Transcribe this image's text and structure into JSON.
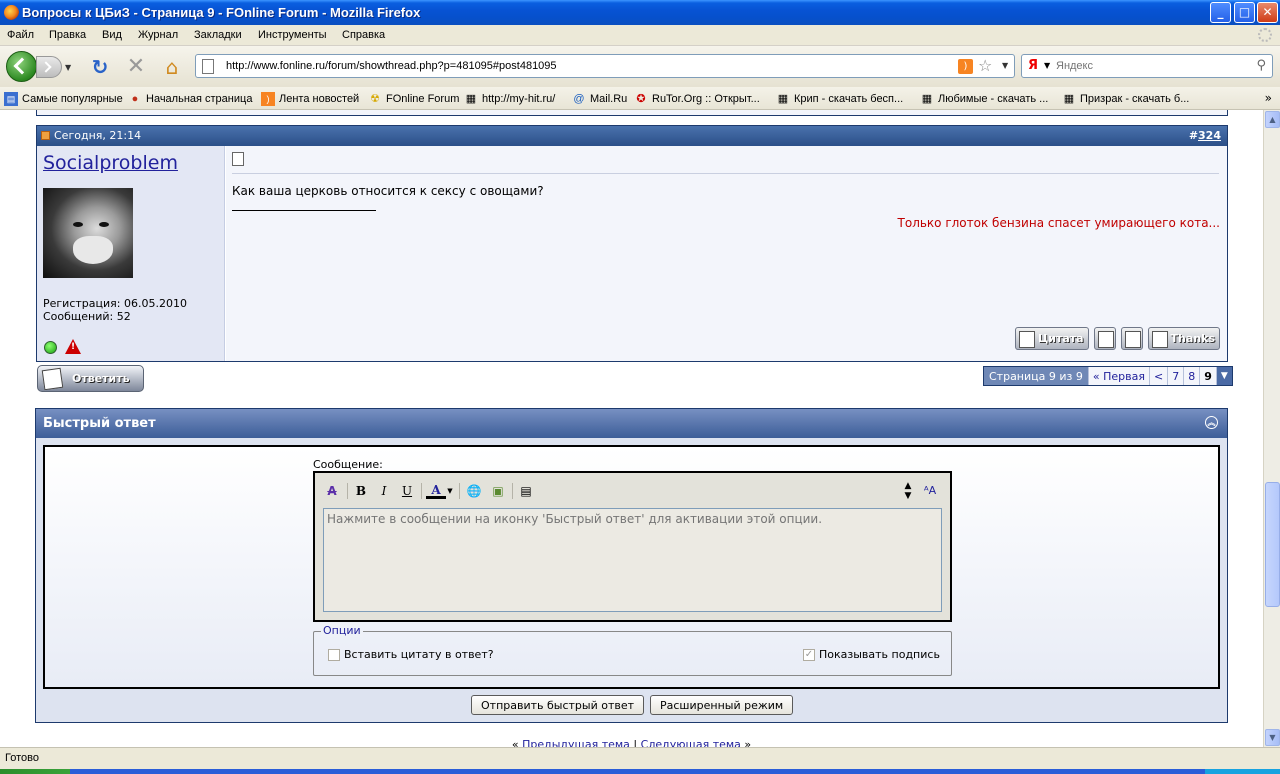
{
  "window": {
    "title": "Вопросы к ЦБиЗ - Страница 9 - FOnline Forum - Mozilla Firefox",
    "minimize": "_",
    "maximize": "□",
    "close": "✕"
  },
  "menu": [
    "Файл",
    "Правка",
    "Вид",
    "Журнал",
    "Закладки",
    "Инструменты",
    "Справка"
  ],
  "nav": {
    "url": "http://www.fonline.ru/forum/showthread.php?p=481095#post481095",
    "search_engine": "Я",
    "search_placeholder": "Яндекс"
  },
  "bookmarks": [
    {
      "label": "Самые популярные",
      "icon": "folder-icon"
    },
    {
      "label": "Начальная страница",
      "icon": "firefox-icon"
    },
    {
      "label": "Лента новостей",
      "icon": "rss-icon"
    },
    {
      "label": "FOnline Forum",
      "icon": "radiation-icon"
    },
    {
      "label": "http://my-hit.ru/",
      "icon": "film-icon"
    },
    {
      "label": "Mail.Ru",
      "icon": "at-icon"
    },
    {
      "label": "RuTor.Org :: Открыт...",
      "icon": "rutor-icon"
    },
    {
      "label": "Крип - скачать бесп...",
      "icon": "film-icon"
    },
    {
      "label": "Любимые - скачать ...",
      "icon": "film-icon"
    },
    {
      "label": "Призрак - скачать б...",
      "icon": "film-icon"
    }
  ],
  "bookmarks_more": "»",
  "post": {
    "datetime": "Сегодня, 21:14",
    "number_prefix": "#",
    "number": "324",
    "username": "Socialproblem",
    "registration": "Регистрация: 06.05.2010",
    "messages": "Сообщений: 52",
    "message": "Как ваша церковь относится к сексу с овощами?",
    "signature": "Только глоток бензина спасет умирающего кота...",
    "buttons": {
      "quote": "Цитата",
      "thanks": "Thanks"
    }
  },
  "reply_button": "Ответить",
  "pager": {
    "info": "Страница 9 из 9",
    "first": "« Первая",
    "prev": "<",
    "pages": [
      "7",
      "8"
    ],
    "current": "9",
    "drop": "▼"
  },
  "quick_reply": {
    "title": "Быстрый ответ",
    "message_label": "Сообщение:",
    "placeholder": "Нажмите в сообщении на иконку 'Быстрый ответ' для активации этой опции.",
    "options_legend": "Опции",
    "insert_quote": "Вставить цитату в ответ?",
    "show_signature": "Показывать подпись",
    "submit": "Отправить быстрый ответ",
    "advanced": "Расширенный режим"
  },
  "thread_nav": {
    "prev": "Предыдущая тема",
    "sep": "|",
    "next": "Следующая тема"
  },
  "status": "Готово"
}
